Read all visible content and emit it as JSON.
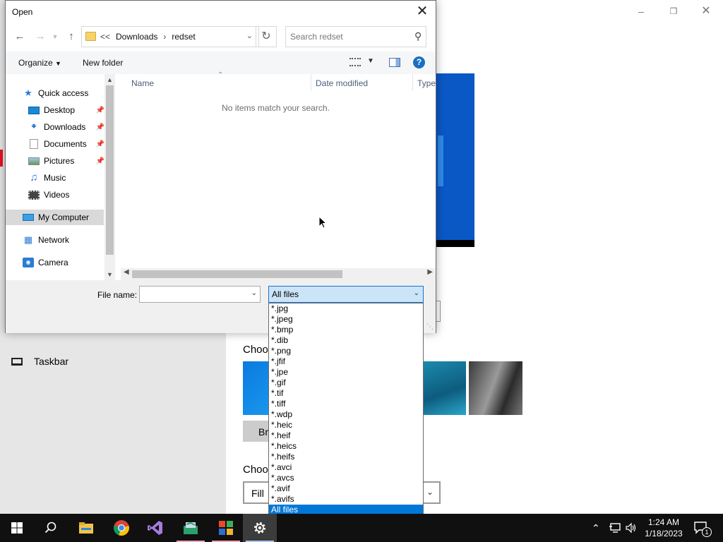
{
  "settings": {
    "nav_taskbar": "Taskbar",
    "choose_picture_label": "Choos",
    "choose_fit_label": "Choos",
    "browse_label": "Br",
    "fit_value": "Fill"
  },
  "dialog": {
    "title": "Open",
    "breadcrumb": [
      "Downloads",
      "redset"
    ],
    "breadcrumb_overflow": "<<",
    "search_placeholder": "Search redset",
    "commands": {
      "organize": "Organize",
      "new_folder": "New folder"
    },
    "nav": [
      {
        "label": "Quick access",
        "icon": "star-icon"
      },
      {
        "label": "Desktop",
        "icon": "desktop-icon",
        "pinned": true
      },
      {
        "label": "Downloads",
        "icon": "download-icon",
        "pinned": true
      },
      {
        "label": "Documents",
        "icon": "documents-icon",
        "pinned": true
      },
      {
        "label": "Pictures",
        "icon": "pictures-icon",
        "pinned": true
      },
      {
        "label": "Music",
        "icon": "music-icon"
      },
      {
        "label": "Videos",
        "icon": "videos-icon"
      },
      {
        "label": "My Computer",
        "icon": "computer-icon",
        "selected": true
      },
      {
        "label": "Network",
        "icon": "network-icon"
      },
      {
        "label": "Camera",
        "icon": "camera-icon"
      }
    ],
    "columns": [
      "Name",
      "Date modified",
      "Type"
    ],
    "empty_message": "No items match your search.",
    "file_name_label": "File name:",
    "file_name_value": "",
    "file_type_value": "All files",
    "file_type_options": [
      "*.jpg",
      "*.jpeg",
      "*.bmp",
      "*.dib",
      "*.png",
      "*.jfif",
      "*.jpe",
      "*.gif",
      "*.tif",
      "*.tiff",
      "*.wdp",
      "*.heic",
      "*.heif",
      "*.heics",
      "*.heifs",
      "*.avci",
      "*.avcs",
      "*.avif",
      "*.avifs",
      "All files"
    ],
    "file_type_selected": "All files"
  },
  "taskbar": {
    "apps": [
      "start-icon",
      "search-icon",
      "file-explorer-icon",
      "chrome-icon",
      "visual-studio-icon",
      "app-icon",
      "app2-icon",
      "settings-icon"
    ],
    "time": "1:24 AM",
    "date": "1/18/2023",
    "notification_count": "1"
  }
}
